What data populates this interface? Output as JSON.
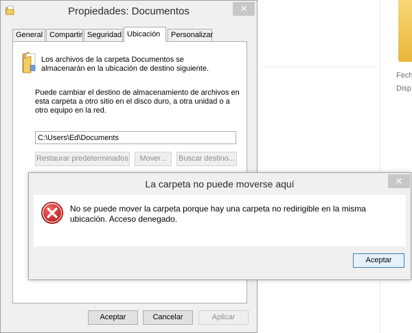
{
  "background": {
    "texts": [
      "Fech",
      "Disp"
    ]
  },
  "properties_window": {
    "title": "Propiedades: Documentos",
    "close_glyph": "✕",
    "tabs": [
      {
        "label": "General",
        "active": false
      },
      {
        "label": "Compartir",
        "active": false
      },
      {
        "label": "Seguridad",
        "active": false
      },
      {
        "label": "Ubicación",
        "active": true
      },
      {
        "label": "Personalizar",
        "active": false
      }
    ],
    "location": {
      "intro_lines": [
        "Los archivos de la carpeta Documentos se",
        "almacenarán en la ubicación de destino siguiente."
      ],
      "change_lines": [
        "Puede cambiar el destino de almacenamiento de archivos en",
        "esta carpeta a otro sitio en el disco duro, a otra unidad o a",
        "otro equipo en la red."
      ],
      "path_value": "C:\\Users\\Ed\\Documents",
      "restore_label": "Restaurar predeterminados",
      "move_label": "Mover...",
      "find_label": "Buscar destino..."
    },
    "footer": {
      "ok_label": "Aceptar",
      "cancel_label": "Cancelar",
      "apply_label": "Aplicar"
    }
  },
  "error_dialog": {
    "title": "La carpeta no puede moverse aquí",
    "close_glyph": "✕",
    "message": "No se puede mover la carpeta porque hay una carpeta no redirigible en la misma ubicación. Acceso denegado.",
    "ok_label": "Aceptar",
    "icon": "error-icon",
    "icon_color": "#d32f2f"
  }
}
